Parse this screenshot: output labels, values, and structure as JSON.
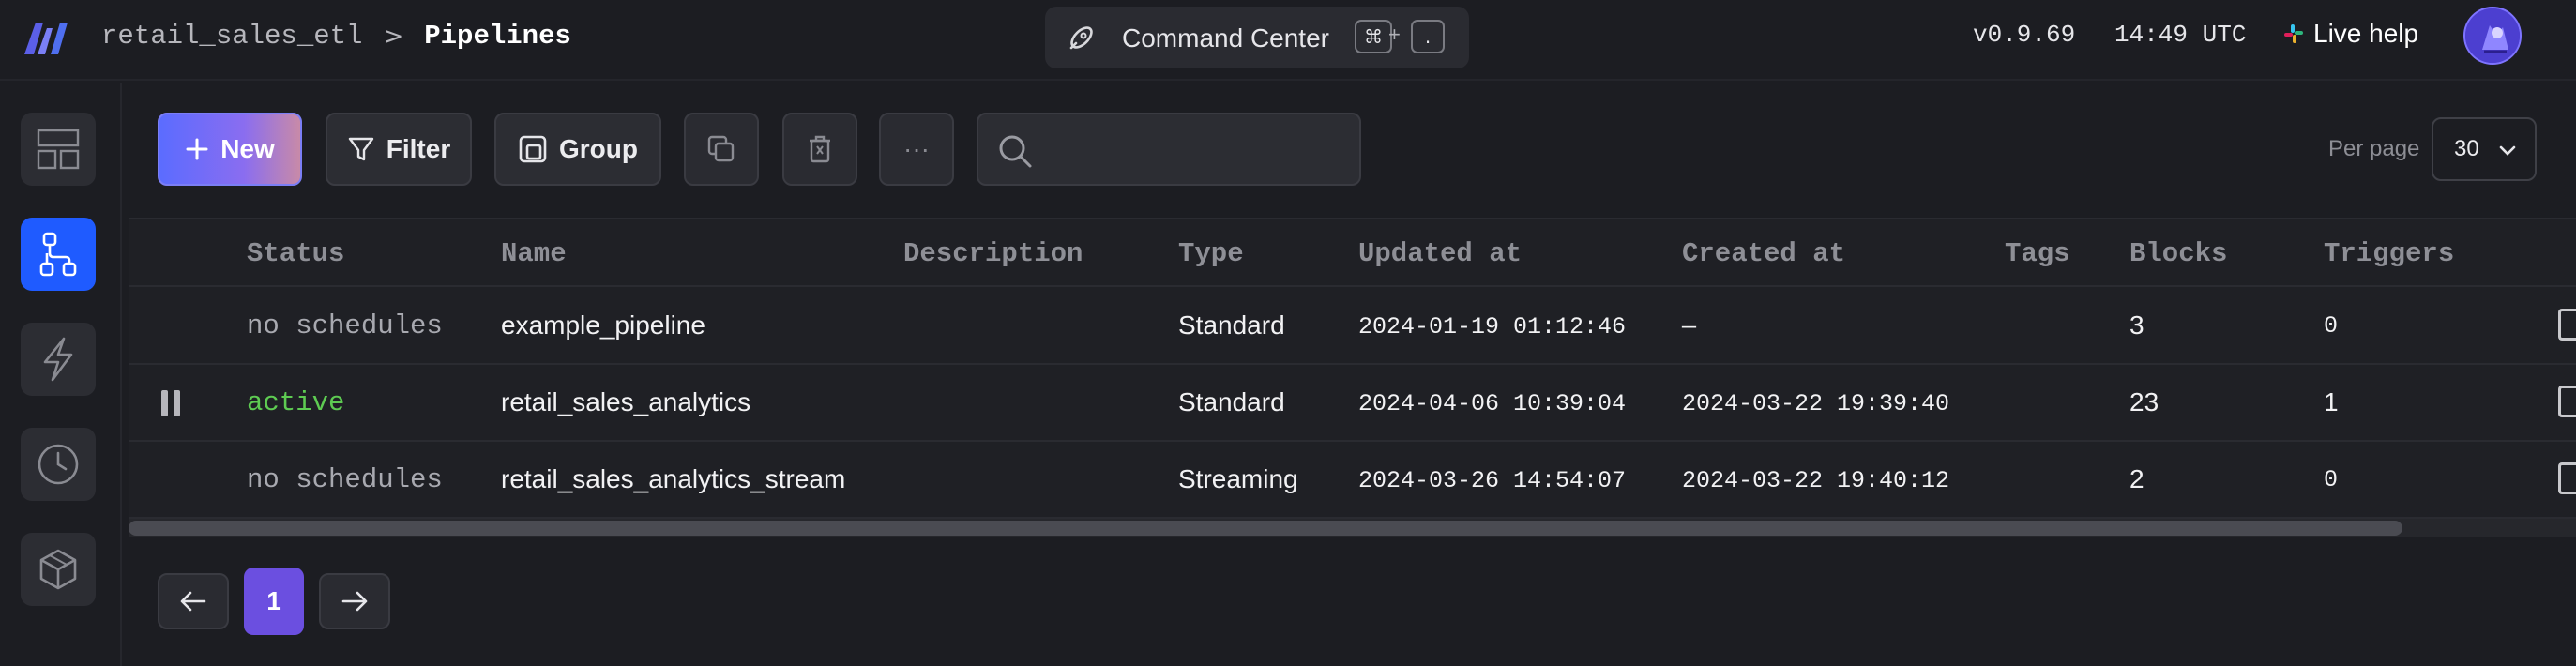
{
  "header": {
    "project": "retail_sales_etl",
    "separator": ">",
    "current_page": "Pipelines",
    "command_center": {
      "label": "Command Center",
      "key1": "⌘",
      "plus": "+",
      "key2": "."
    },
    "version": "v0.9.69",
    "time": "14:49 UTC",
    "live_help": "Live help",
    "logo_icon": "mage-logo-icon",
    "avatar_icon": "user-avatar-icon"
  },
  "sidebar": {
    "items": [
      {
        "name": "dashboard",
        "icon": "layout-icon",
        "active": false
      },
      {
        "name": "pipelines",
        "icon": "pipeline-tree-icon",
        "active": true
      },
      {
        "name": "triggers",
        "icon": "lightning-icon",
        "active": false
      },
      {
        "name": "history",
        "icon": "clock-icon",
        "active": false
      },
      {
        "name": "blocks",
        "icon": "cube-icon",
        "active": false
      }
    ]
  },
  "toolbar": {
    "new_label": "New",
    "filter_label": "Filter",
    "group_label": "Group",
    "more_label": "···",
    "search_placeholder": "",
    "per_page_label": "Per page",
    "per_page_value": "30"
  },
  "table": {
    "columns": [
      "Status",
      "Name",
      "Description",
      "Type",
      "Updated at",
      "Created at",
      "Tags",
      "Blocks",
      "Triggers"
    ],
    "rows": [
      {
        "status": "no schedules",
        "status_active": false,
        "name": "example_pipeline",
        "description": "",
        "type": "Standard",
        "updated_at": "2024-01-19 01:12:46",
        "created_at": "—",
        "tags": "",
        "blocks": "3",
        "triggers": "0"
      },
      {
        "status": "active",
        "status_active": true,
        "name": "retail_sales_analytics",
        "description": "",
        "type": "Standard",
        "updated_at": "2024-04-06 10:39:04",
        "created_at": "2024-03-22 19:39:40",
        "tags": "",
        "blocks": "23",
        "triggers": "1"
      },
      {
        "status": "no schedules",
        "status_active": false,
        "name": "retail_sales_analytics_stream",
        "description": "",
        "type": "Streaming",
        "updated_at": "2024-03-26 14:54:07",
        "created_at": "2024-03-22 19:40:12",
        "tags": "",
        "blocks": "2",
        "triggers": "0"
      }
    ]
  },
  "pagination": {
    "current_page": "1"
  },
  "colors": {
    "accent": "#6b4fe0",
    "active_nav": "#1f5bff",
    "active_status": "#5ecb52",
    "background": "#1c1d22"
  }
}
